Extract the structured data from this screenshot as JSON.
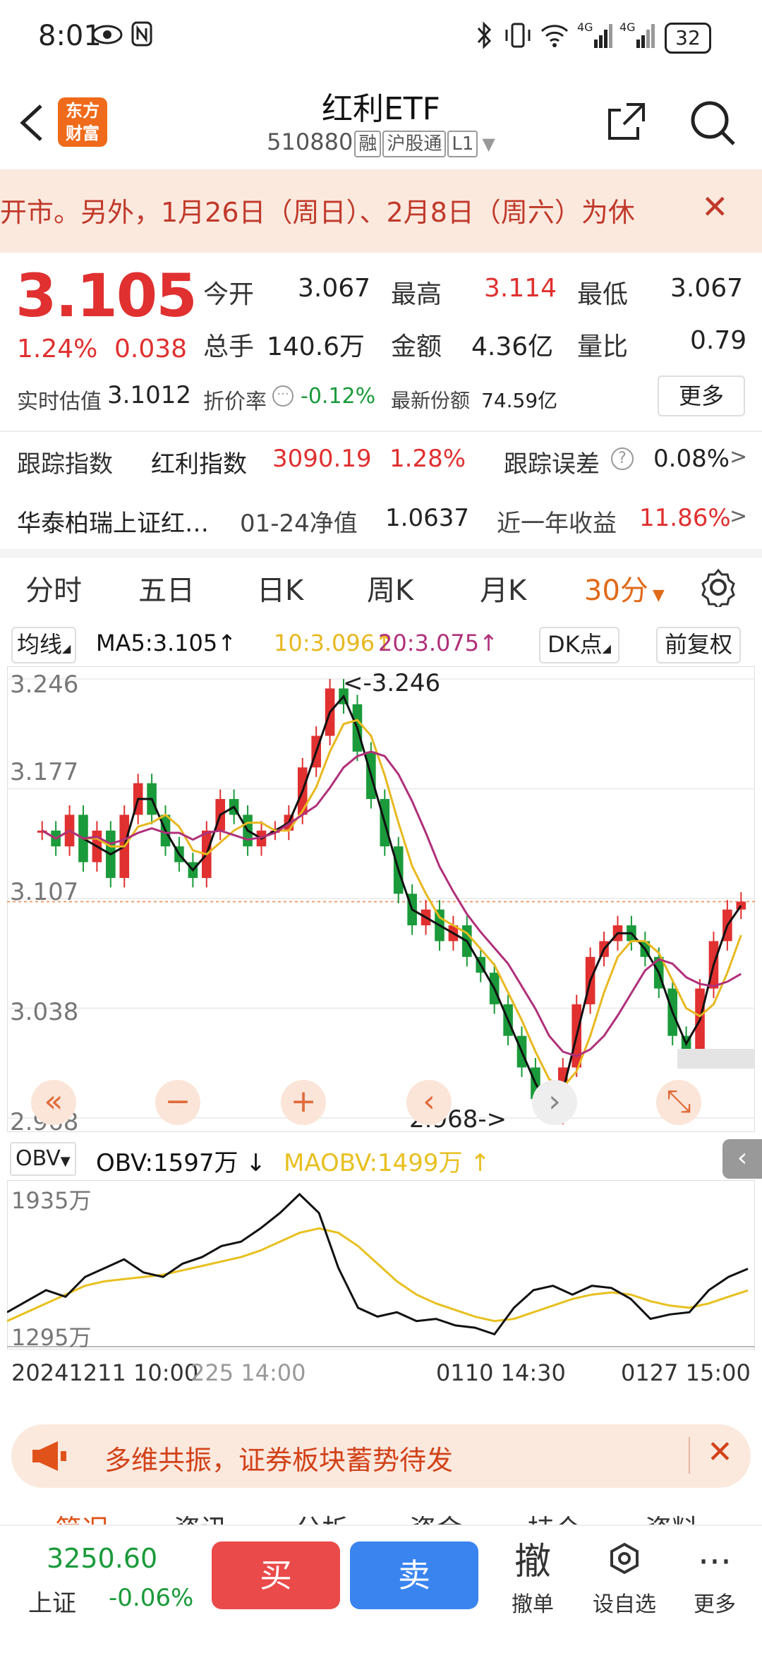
{
  "status_bar": {
    "time": "8:01",
    "battery": "32"
  },
  "header": {
    "title": "红利ETF",
    "code": "510880",
    "tags": [
      "融",
      "沪股通",
      "L1"
    ],
    "logo_text": "东方财富"
  },
  "notice": {
    "text": "开市。另外，1月26日（周日）、2月8日（周六）为休"
  },
  "quote": {
    "price": "3.105",
    "change_pct": "1.24%",
    "change_abs": "0.038",
    "fields": [
      {
        "label": "今开",
        "value": "3.067"
      },
      {
        "label": "最高",
        "value": "3.114"
      },
      {
        "label": "最低",
        "value": "3.067"
      },
      {
        "label": "总手",
        "value": "140.6万"
      },
      {
        "label": "金额",
        "value": "4.36亿"
      },
      {
        "label": "量比",
        "value": "0.79"
      }
    ],
    "iopv_label": "实时估值",
    "iopv_value": "3.1012",
    "discount_label": "折价率",
    "discount_value": "-0.12%",
    "shares_label": "最新份额",
    "shares_value": "74.59亿",
    "more_label": "更多"
  },
  "tracking": {
    "label": "跟踪指数",
    "index_name": "红利指数",
    "index_value": "3090.19",
    "index_pct": "1.28%",
    "error_label": "跟踪误差",
    "error_value": "0.08%"
  },
  "fund": {
    "name": "华泰柏瑞上证红…",
    "nav_label": "01-24净值",
    "nav_value": "1.0637",
    "yield_label": "近一年收益",
    "yield_value": "11.86%"
  },
  "tabs": [
    "分时",
    "五日",
    "日K",
    "周K",
    "月K",
    "30分"
  ],
  "active_tab": "30分",
  "ma_bar": {
    "selector": "均线",
    "ma5": "MA5:3.105",
    "ma10": "10:3.096",
    "ma20": "20:3.075",
    "dk_label": "DK点",
    "adj_label": "前复权"
  },
  "chart_data": [
    {
      "type": "candlestick",
      "y_ticks": [
        "3.246",
        "3.177",
        "3.107",
        "3.038",
        "2.968"
      ],
      "ylim": [
        2.968,
        3.246
      ],
      "max_annotation": "<-3.246",
      "min_annotation": "2.968->",
      "x_labels": [
        "20241211 10:00",
        "225 14:00",
        "0110 14:30",
        "0127 15:00"
      ],
      "ma_colors": {
        "ma5": "#111111",
        "ma10": "#e8b820",
        "ma20": "#b0307a"
      },
      "close_series": [
        3.15,
        3.14,
        3.16,
        3.13,
        3.15,
        3.12,
        3.16,
        3.18,
        3.16,
        3.14,
        3.13,
        3.12,
        3.15,
        3.17,
        3.16,
        3.14,
        3.15,
        3.15,
        3.16,
        3.19,
        3.21,
        3.24,
        3.23,
        3.2,
        3.17,
        3.14,
        3.11,
        3.09,
        3.1,
        3.08,
        3.09,
        3.07,
        3.06,
        3.04,
        3.02,
        3.0,
        2.98,
        2.97,
        3.0,
        3.04,
        3.07,
        3.08,
        3.09,
        3.08,
        3.07,
        3.05,
        3.02,
        3.01,
        3.05,
        3.08,
        3.1,
        3.105
      ]
    },
    {
      "type": "line",
      "indicator": "OBV",
      "obv_label": "OBV:1597万",
      "maobv_label": "MAOBV:1499万",
      "y_ticks": [
        "1935万",
        "1295万"
      ],
      "ylim": [
        1295,
        1935
      ],
      "obv_series": [
        1400,
        1450,
        1500,
        1470,
        1560,
        1600,
        1640,
        1580,
        1560,
        1620,
        1650,
        1700,
        1720,
        1780,
        1850,
        1935,
        1850,
        1600,
        1420,
        1380,
        1400,
        1360,
        1370,
        1340,
        1330,
        1300,
        1420,
        1500,
        1520,
        1480,
        1520,
        1510,
        1460,
        1370,
        1390,
        1400,
        1500,
        1560,
        1597
      ],
      "maobv_series": [
        1360,
        1400,
        1440,
        1480,
        1520,
        1540,
        1550,
        1560,
        1570,
        1590,
        1610,
        1630,
        1650,
        1680,
        1720,
        1760,
        1780,
        1760,
        1700,
        1620,
        1540,
        1480,
        1440,
        1410,
        1380,
        1360,
        1370,
        1400,
        1430,
        1460,
        1480,
        1490,
        1480,
        1450,
        1430,
        1420,
        1440,
        1470,
        1499
      ],
      "colors": {
        "obv": "#111111",
        "maobv": "#e8c020"
      }
    }
  ],
  "obv_selector": "OBV",
  "news": {
    "text": "多维共振，证券板块蓄势待发"
  },
  "bottom_tabs": [
    "简况",
    "资讯",
    "分析",
    "资金",
    "持仓",
    "资料"
  ],
  "bottom_bar": {
    "index_value": "3250.60",
    "index_name": "上证",
    "index_pct": "-0.06%",
    "buy_label": "买",
    "sell_label": "卖",
    "cancel_big": "撤",
    "cancel_label": "撤单",
    "watch_label": "设自选",
    "more_label": "更多"
  }
}
